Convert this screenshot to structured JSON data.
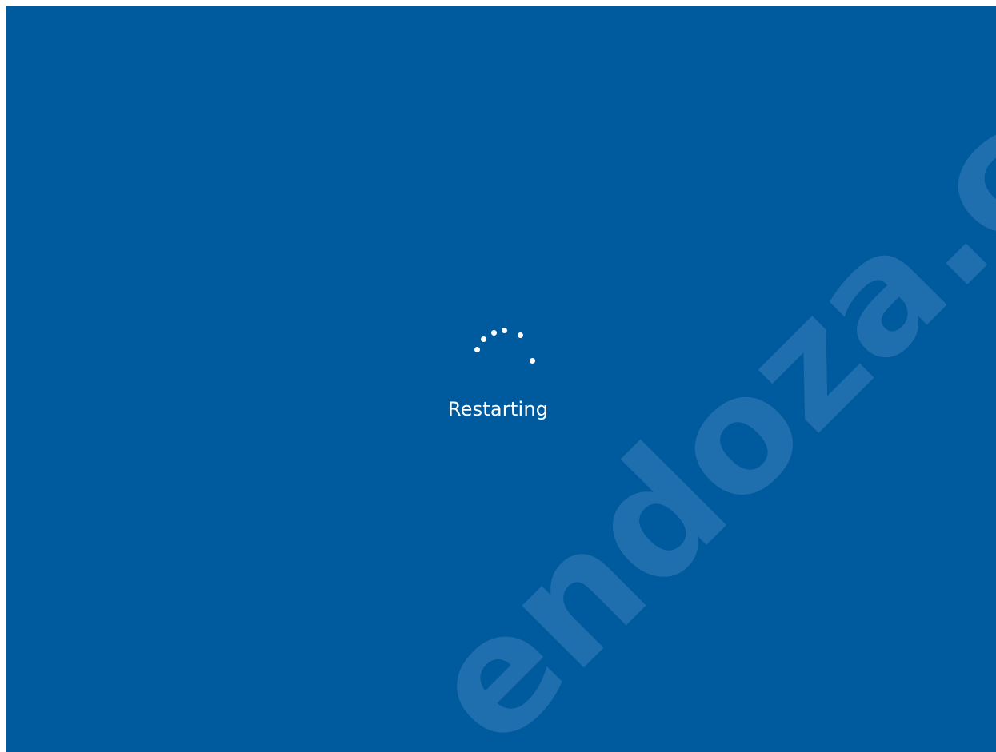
{
  "screen": {
    "background": "#005a9e",
    "status_text": "Restarting",
    "spinner_icon": "loading-dots-spinner"
  },
  "watermark": {
    "text": "endoza.com",
    "color": "#2a76b4"
  }
}
